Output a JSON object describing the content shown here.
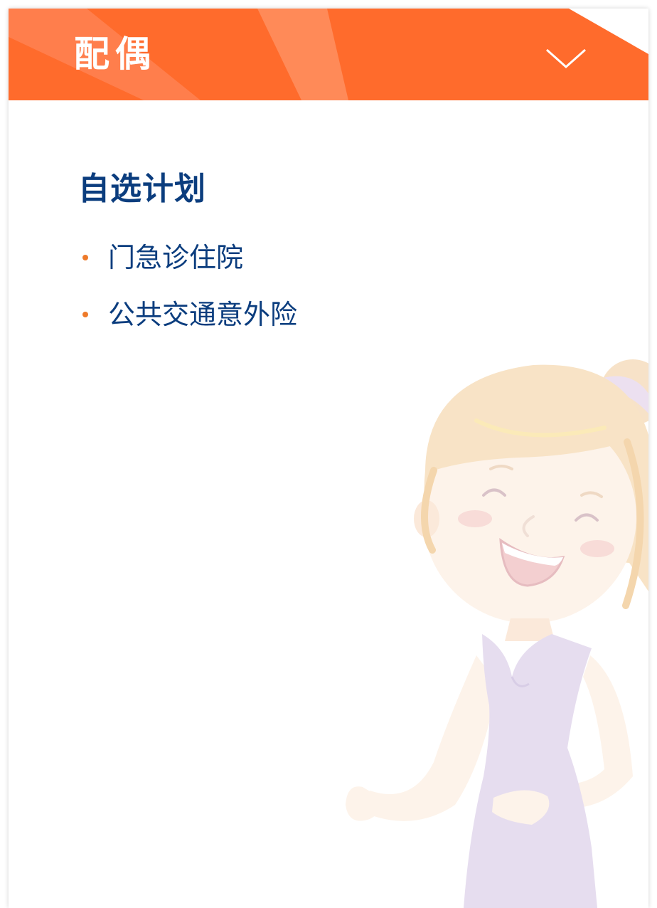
{
  "header": {
    "title": "配偶",
    "toggle_icon": "chevron-down-icon"
  },
  "section": {
    "title": "自选计划"
  },
  "plan_items": [
    {
      "label": "门急诊住院"
    },
    {
      "label": "公共交通意外险"
    }
  ],
  "colors": {
    "header_orange": "#ff6b2c",
    "header_stripe": "#ff8a55",
    "title_blue": "#0b3d7e",
    "bullet_orange": "#ee7a2a",
    "dress_lavender": "#e6ddef",
    "skin_light": "#fdf3ea",
    "hair_light": "#f8e3c6"
  },
  "illustration": {
    "icon": "smiling-woman-illustration"
  }
}
